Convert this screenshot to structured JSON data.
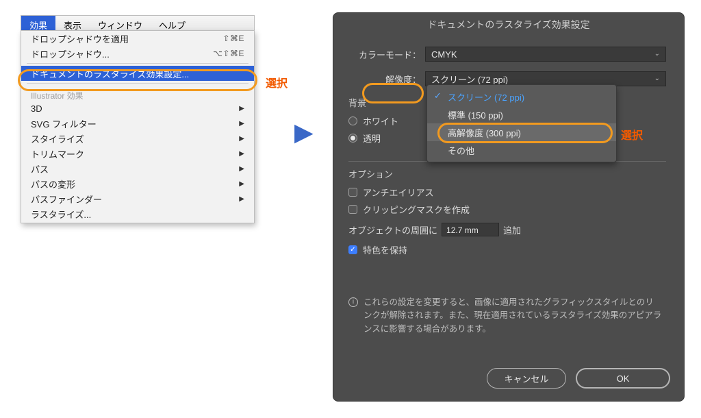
{
  "annotation": {
    "select": "選択"
  },
  "menubar": {
    "items": [
      "効果",
      "表示",
      "ウィンドウ",
      "ヘルプ"
    ],
    "active_index": 0
  },
  "menu": {
    "apply_drop_shadow": {
      "label": "ドロップシャドウを適用",
      "shortcut": "⇧⌘E"
    },
    "drop_shadow": {
      "label": "ドロップシャドウ...",
      "shortcut": "⌥⇧⌘E"
    },
    "raster_settings": {
      "label": "ドキュメントのラスタライズ効果設定..."
    },
    "section": {
      "label": "Illustrator 効果"
    },
    "sub": {
      "threeD": "3D",
      "svgFilter": "SVG フィルター",
      "stylize": "スタイライズ",
      "trimMarks": "トリムマーク",
      "path": "パス",
      "pathDeform": "パスの変形",
      "pathfinder": "パスファインダー",
      "rasterize": "ラスタライズ..."
    }
  },
  "dialog": {
    "title": "ドキュメントのラスタライズ効果設定",
    "color_mode": {
      "label": "カラーモード：",
      "value": "CMYK"
    },
    "resolution": {
      "label": "解像度：",
      "value": "スクリーン (72 ppi)",
      "options": [
        "スクリーン (72 ppi)",
        "標準 (150 ppi)",
        "高解像度 (300 ppi)",
        "その他"
      ],
      "selected_index": 0,
      "highlight_index": 2
    },
    "background": {
      "title": "背景",
      "white": "ホワイト",
      "transparent": "透明",
      "selected": "transparent"
    },
    "options": {
      "title": "オプション",
      "antialias": {
        "label": "アンチエイリアス",
        "checked": false
      },
      "clipmask": {
        "label": "クリッピングマスクを作成",
        "checked": false
      },
      "padding": {
        "prefix": "オブジェクトの周囲に",
        "value": "12.7 mm",
        "suffix": "追加"
      },
      "preserve_spot": {
        "label": "特色を保持",
        "checked": true
      }
    },
    "info": "これらの設定を変更すると、画像に適用されたグラフィックスタイルとのリンクが解除されます。また、現在適用されているラスタライズ効果のアピアランスに影響する場合があります。",
    "buttons": {
      "cancel": "キャンセル",
      "ok": "OK"
    }
  }
}
